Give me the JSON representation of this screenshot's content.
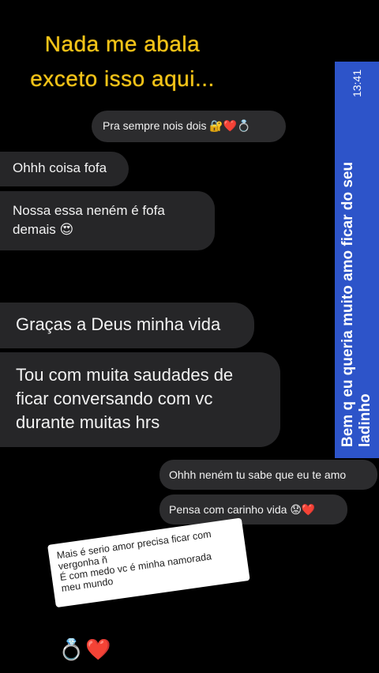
{
  "title": {
    "line1": "Nada me abala",
    "line2": "exceto isso aqui..."
  },
  "messages": [
    {
      "text": "Pra sempre nois dois",
      "emoji": "🔐❤️💍"
    },
    {
      "text": "Ohhh coisa fofa"
    },
    {
      "text": "Nossa essa neném é fofa demais",
      "emoji": "😍"
    },
    {
      "text": "Graças a Deus minha vida"
    },
    {
      "text": "Tou com muita saudades de ficar conversando com vc durante muitas hrs"
    },
    {
      "text": "Ohhh neném tu sabe que eu te amo"
    },
    {
      "text": "Pensa com carinho vida",
      "emoji": "😟❤️"
    }
  ],
  "side_panel": {
    "text": "Bem q eu queria muito amo ficar do seu ladinho",
    "time": "13:41",
    "color": "#2d54c9"
  },
  "sticker_note": {
    "line1": "Mais é serio amor precisa ficar com",
    "line2": "vergonha ñ",
    "line3": "É com medo vc é minha namorada",
    "line4": "meu mundo"
  },
  "bottom_emoji": "💍❤️"
}
